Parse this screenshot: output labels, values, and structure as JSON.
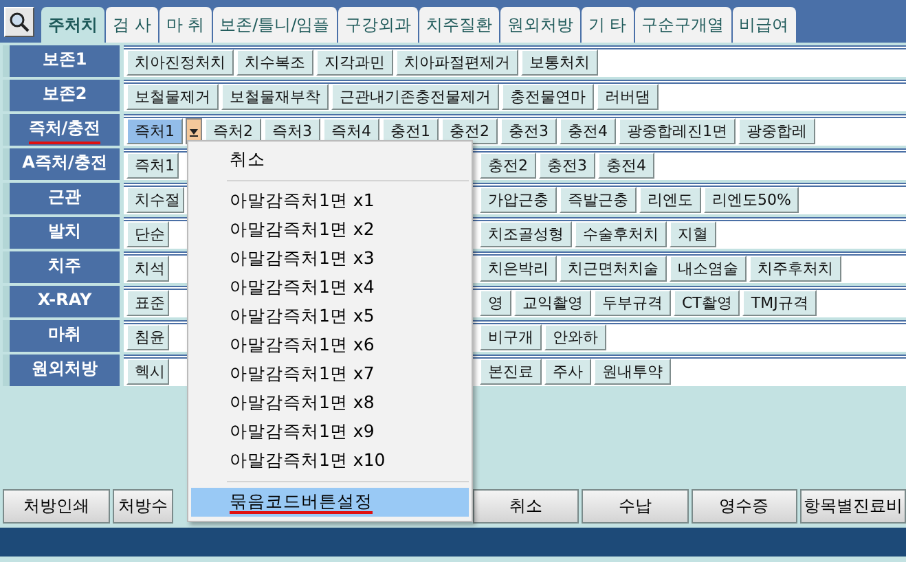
{
  "tabs": [
    {
      "label": "주처치",
      "selected": true
    },
    {
      "label": "검 사",
      "selected": false
    },
    {
      "label": "마 취",
      "selected": false
    },
    {
      "label": "보존/틀니/임플",
      "selected": false
    },
    {
      "label": "구강외과",
      "selected": false
    },
    {
      "label": "치주질환",
      "selected": false
    },
    {
      "label": "원외처방",
      "selected": false
    },
    {
      "label": "기 타",
      "selected": false
    },
    {
      "label": "구순구개열",
      "selected": false
    },
    {
      "label": "비급여",
      "selected": false
    }
  ],
  "rows": [
    {
      "label": "보존1",
      "active": false,
      "covered": false,
      "buttons": [
        {
          "text": "치아진정처치",
          "selected": false
        },
        {
          "text": "치수복조",
          "selected": false
        },
        {
          "text": "지각과민",
          "selected": false
        },
        {
          "text": "치아파절편제거",
          "selected": false
        },
        {
          "text": "보통처치",
          "selected": false
        }
      ]
    },
    {
      "label": "보존2",
      "active": false,
      "covered": false,
      "buttons": [
        {
          "text": "보철물제거",
          "selected": false
        },
        {
          "text": "보철물재부착",
          "selected": false
        },
        {
          "text": "근관내기존충전물제거",
          "selected": false
        },
        {
          "text": "충전물연마",
          "selected": false
        },
        {
          "text": "러버댐",
          "selected": false
        }
      ]
    },
    {
      "label": "즉처/충전",
      "active": true,
      "covered": false,
      "buttons": [
        {
          "text": "즉처1",
          "selected": true
        },
        {
          "text": "즉처2",
          "selected": false
        },
        {
          "text": "즉처3",
          "selected": false
        },
        {
          "text": "즉처4",
          "selected": false
        },
        {
          "text": "충전1",
          "selected": false
        },
        {
          "text": "충전2",
          "selected": false
        },
        {
          "text": "충전3",
          "selected": false
        },
        {
          "text": "충전4",
          "selected": false
        },
        {
          "text": "광중합레진1면",
          "selected": false
        },
        {
          "text": "광중합레",
          "selected": false
        }
      ]
    },
    {
      "label": "A즉처/충전",
      "active": false,
      "covered": true,
      "buttons": [
        {
          "text": "즉처1",
          "selected": false
        },
        {
          "text": "충전2",
          "selected": false
        },
        {
          "text": "충전3",
          "selected": false
        },
        {
          "text": "충전4",
          "selected": false
        }
      ]
    },
    {
      "label": "근관",
      "active": false,
      "covered": true,
      "buttons": [
        {
          "text": "치수절",
          "selected": false
        },
        {
          "text": "가압근충",
          "selected": false
        },
        {
          "text": "즉발근충",
          "selected": false
        },
        {
          "text": "리엔도",
          "selected": false
        },
        {
          "text": "리엔도50%",
          "selected": false
        }
      ]
    },
    {
      "label": "발치",
      "active": false,
      "covered": true,
      "buttons": [
        {
          "text": "단순",
          "selected": false
        },
        {
          "text": "치조골성형",
          "selected": false
        },
        {
          "text": "수술후처치",
          "selected": false
        },
        {
          "text": "지혈",
          "selected": false
        }
      ]
    },
    {
      "label": "치주",
      "active": false,
      "covered": true,
      "buttons": [
        {
          "text": "치석",
          "selected": false
        },
        {
          "text": "치은박리",
          "selected": false
        },
        {
          "text": "치근면처치술",
          "selected": false
        },
        {
          "text": "내소염술",
          "selected": false
        },
        {
          "text": "치주후처치",
          "selected": false
        }
      ]
    },
    {
      "label": "X-RAY",
      "active": false,
      "covered": true,
      "buttons": [
        {
          "text": "표준",
          "selected": false
        },
        {
          "text": "영",
          "selected": false
        },
        {
          "text": "교익촬영",
          "selected": false
        },
        {
          "text": "두부규격",
          "selected": false
        },
        {
          "text": "CT촬영",
          "selected": false
        },
        {
          "text": "TMJ규격",
          "selected": false
        }
      ]
    },
    {
      "label": "마취",
      "active": false,
      "covered": true,
      "buttons": [
        {
          "text": "침윤",
          "selected": false
        },
        {
          "text": "비구개",
          "selected": false
        },
        {
          "text": "안와하",
          "selected": false
        }
      ]
    },
    {
      "label": "원외처방",
      "active": false,
      "covered": true,
      "buttons": [
        {
          "text": "헥시",
          "selected": false
        },
        {
          "text": "본진료",
          "selected": false
        },
        {
          "text": "주사",
          "selected": false
        },
        {
          "text": "원내투약",
          "selected": false
        }
      ]
    }
  ],
  "menu": {
    "items": [
      {
        "kind": "command",
        "label": "취소",
        "highlighted": false
      },
      {
        "kind": "separator"
      },
      {
        "kind": "command",
        "label": "아말감즉처1면 x1",
        "highlighted": false
      },
      {
        "kind": "command",
        "label": "아말감즉처1면 x2",
        "highlighted": false
      },
      {
        "kind": "command",
        "label": "아말감즉처1면 x3",
        "highlighted": false
      },
      {
        "kind": "command",
        "label": "아말감즉처1면 x4",
        "highlighted": false
      },
      {
        "kind": "command",
        "label": "아말감즉처1면 x5",
        "highlighted": false
      },
      {
        "kind": "command",
        "label": "아말감즉처1면 x6",
        "highlighted": false
      },
      {
        "kind": "command",
        "label": "아말감즉처1면 x7",
        "highlighted": false
      },
      {
        "kind": "command",
        "label": "아말감즉처1면 x8",
        "highlighted": false
      },
      {
        "kind": "command",
        "label": "아말감즉처1면 x9",
        "highlighted": false
      },
      {
        "kind": "command",
        "label": "아말감즉처1면 x10",
        "highlighted": false
      },
      {
        "kind": "separator"
      },
      {
        "kind": "command",
        "label": "묶음코드버튼설정",
        "highlighted": true
      }
    ]
  },
  "bottom_left": [
    "처방인쇄",
    "처방수"
  ],
  "bottom_right": [
    "취소",
    "수납",
    "영수증",
    "항목별진료비"
  ]
}
